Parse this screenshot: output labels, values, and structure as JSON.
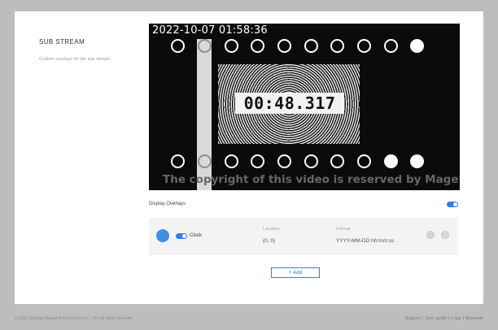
{
  "section": {
    "title": "SUB STREAM",
    "description": "Custom overlays for the sub stream."
  },
  "preview": {
    "timestamp": "2022-10-07 01:58:36",
    "timer": "00:48.317",
    "watermark": "The copyright of this video is reserved by Magewell"
  },
  "overlays": {
    "label": "Display Overlays",
    "enabled": true,
    "items": [
      {
        "type": "Clock",
        "enabled": true,
        "color": "#3d8fe8",
        "location_label": "Location",
        "location_value": "(0, 0)",
        "format_label": "Format",
        "format_value": "YYYY-MM-DD hh:mm:ss"
      }
    ],
    "add_label": "+ Add"
  },
  "footer": {
    "copyright": "© 2022 Nanjing Magewell Electronics Co., Ltd. All rights reserved.",
    "links": [
      "Support",
      "User guide",
      "Logs",
      "Warranty"
    ]
  },
  "colors": {
    "accent": "#2b7de9",
    "page_background": "#ffffff",
    "outer_background": "#bdbdbd"
  },
  "icons": [
    "edit-icon",
    "delete-icon"
  ]
}
